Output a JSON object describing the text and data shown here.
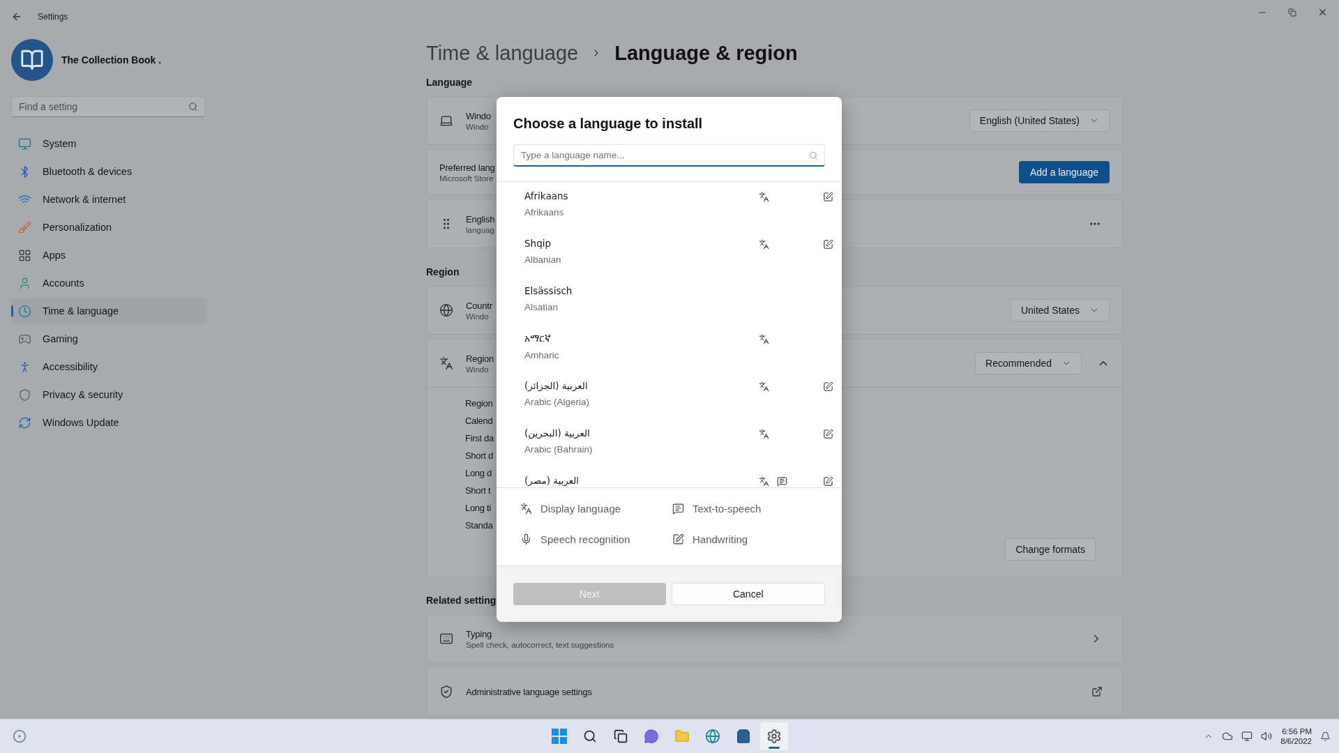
{
  "window": {
    "title": "Settings"
  },
  "account": {
    "name": "The Collection Book ."
  },
  "search": {
    "placeholder": "Find a setting"
  },
  "nav": [
    {
      "label": "System",
      "selected": false
    },
    {
      "label": "Bluetooth & devices",
      "selected": false
    },
    {
      "label": "Network & internet",
      "selected": false
    },
    {
      "label": "Personalization",
      "selected": false
    },
    {
      "label": "Apps",
      "selected": false
    },
    {
      "label": "Accounts",
      "selected": false
    },
    {
      "label": "Time & language",
      "selected": true
    },
    {
      "label": "Gaming",
      "selected": false
    },
    {
      "label": "Accessibility",
      "selected": false
    },
    {
      "label": "Privacy & security",
      "selected": false
    },
    {
      "label": "Windows Update",
      "selected": false
    }
  ],
  "breadcrumb": {
    "parent": "Time & language",
    "current": "Language & region"
  },
  "sections": [
    {
      "heading": "Language",
      "cards": [
        {
          "kind": "dropdown",
          "title": "Windo",
          "subtitle": "Windo",
          "value": "English (United States)"
        },
        {
          "kind": "button",
          "title": "Preferred lang",
          "subtitle": "Microsoft Store",
          "action": "Add a language"
        },
        {
          "kind": "more",
          "title": "English",
          "subtitle": "languag"
        }
      ]
    },
    {
      "heading": "Region",
      "cards": [
        {
          "kind": "dropdown",
          "title": "Countr",
          "subtitle": "Windo",
          "value": "United States"
        },
        {
          "kind": "expander",
          "title": "Region",
          "subtitle": "Windo",
          "value": "Recommended",
          "expanded": true,
          "rows": [
            "Region",
            "Calend",
            "First da",
            "Short d",
            "Long d",
            "Short t",
            "Long ti",
            "Standa"
          ],
          "action": "Change formats"
        }
      ]
    },
    {
      "heading": "Related setting",
      "cards": [
        {
          "kind": "link",
          "title": "Typing",
          "subtitle": "Spell check, autocorrect, text suggestions"
        },
        {
          "kind": "external",
          "title": "Administrative language settings"
        }
      ]
    }
  ],
  "dialog": {
    "title": "Choose a language to install",
    "placeholder": "Type a language name...",
    "languages": [
      {
        "name": "Afrikaans",
        "english": "Afrikaans",
        "display_language": true,
        "text_to_speech": false,
        "handwriting": true
      },
      {
        "name": "Shqip",
        "english": "Albanian",
        "display_language": true,
        "text_to_speech": false,
        "handwriting": true
      },
      {
        "name": "Elsässisch",
        "english": "Alsatian",
        "display_language": false,
        "text_to_speech": false,
        "handwriting": false
      },
      {
        "name": "አማርኛ",
        "english": "Amharic",
        "display_language": true,
        "text_to_speech": false,
        "handwriting": false
      },
      {
        "name": "العربية (الجزائر)",
        "english": "Arabic (Algeria)",
        "display_language": true,
        "text_to_speech": false,
        "handwriting": true
      },
      {
        "name": "العربية (البحرين)",
        "english": "Arabic (Bahrain)",
        "display_language": true,
        "text_to_speech": false,
        "handwriting": true
      },
      {
        "name": "العربية (مصر)",
        "display_language": true,
        "text_to_speech": true,
        "handwriting": true
      }
    ],
    "legend": [
      {
        "kind": "display",
        "label": "Display language"
      },
      {
        "kind": "tts",
        "label": "Text-to-speech"
      },
      {
        "kind": "speech",
        "label": "Speech recognition"
      },
      {
        "kind": "handwriting",
        "label": "Handwriting"
      }
    ],
    "buttons": [
      {
        "label": "Next",
        "disabled": true
      },
      {
        "label": "Cancel",
        "disabled": false
      }
    ]
  },
  "taskbar": {
    "time": "6:56 PM",
    "date": "8/6/2022"
  }
}
